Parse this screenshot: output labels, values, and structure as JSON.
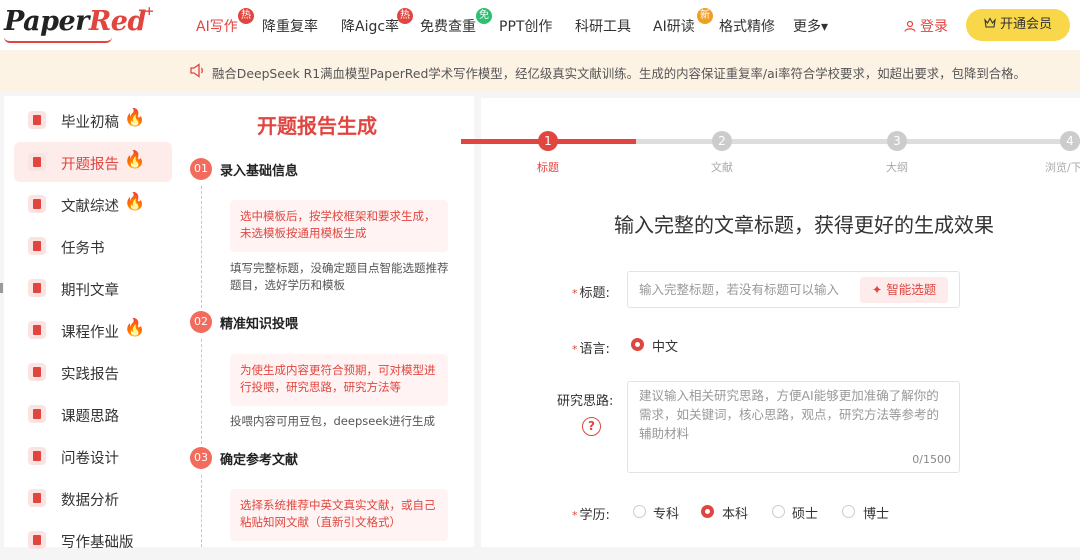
{
  "brand": {
    "name_part1": "Paper",
    "name_part2": "Red",
    "mark": "+"
  },
  "nav": [
    {
      "label": "AI写作",
      "badge": "热",
      "badge_type": "hot",
      "active": true
    },
    {
      "label": "降重复率",
      "badge": "",
      "badge_type": ""
    },
    {
      "label": "降Aigc率",
      "badge": "热",
      "badge_type": "hot"
    },
    {
      "label": "免费查重",
      "badge": "免",
      "badge_type": "free"
    },
    {
      "label": "PPT创作",
      "badge": "",
      "badge_type": ""
    },
    {
      "label": "科研工具",
      "badge": "",
      "badge_type": ""
    },
    {
      "label": "AI研读",
      "badge": "新",
      "badge_type": "new"
    },
    {
      "label": "格式精修",
      "badge": "",
      "badge_type": ""
    },
    {
      "label": "更多▾",
      "badge": "",
      "badge_type": ""
    }
  ],
  "header": {
    "login_label": "登录",
    "vip_label": "开通会员"
  },
  "notice": {
    "text": "融合DeepSeek R1满血模型PaperRed学术写作模型，经亿级真实文献训练。生成的内容保证重复率/ai率符合学校要求，如超出要求，包降到合格。"
  },
  "sidebar": {
    "items": [
      {
        "label": "毕业初稿",
        "hot": true
      },
      {
        "label": "开题报告",
        "hot": true,
        "active": true
      },
      {
        "label": "文献综述",
        "hot": true
      },
      {
        "label": "任务书",
        "hot": false
      },
      {
        "label": "期刊文章",
        "hot": false
      },
      {
        "label": "课程作业",
        "hot": true
      },
      {
        "label": "实践报告",
        "hot": false
      },
      {
        "label": "课题思路",
        "hot": false
      },
      {
        "label": "问卷设计",
        "hot": false
      },
      {
        "label": "数据分析",
        "hot": false
      },
      {
        "label": "写作基础版",
        "hot": false
      }
    ]
  },
  "guide": {
    "title": "开题报告生成",
    "steps": [
      {
        "num": "01",
        "heading": "录入基础信息",
        "tip": "选中模板后，按学校框架和要求生成，未选模板按通用模板生成",
        "desc": "填写完整标题，没确定题目点智能选题推荐题目，选好学历和模板"
      },
      {
        "num": "02",
        "heading": "精准知识投喂",
        "tip": "为使生成内容更符合预期，可对模型进行投喂，研究思路，研究方法等",
        "desc": "投喂内容可用豆包，deepseek进行生成"
      },
      {
        "num": "03",
        "heading": "确定参考文献",
        "tip": "选择系统推荐中英文真实文献，或自己粘贴知网文献（直新引文格式）",
        "desc": ""
      }
    ]
  },
  "progress": {
    "current": 1,
    "steps": [
      {
        "num": "1",
        "label": "标题"
      },
      {
        "num": "2",
        "label": "文献"
      },
      {
        "num": "3",
        "label": "大纲"
      },
      {
        "num": "4",
        "label": "浏览/下"
      }
    ]
  },
  "form": {
    "heading": "输入完整的文章标题，获得更好的生成效果",
    "title_label": "标题:",
    "title_placeholder": "输入完整标题，若没有标题可以输入",
    "smart_button": "智能选题",
    "language_label": "语言:",
    "language_options": [
      {
        "label": "中文",
        "checked": true
      }
    ],
    "thinking_label": "研究思路:",
    "thinking_placeholder": "建议输入相关研究思路，方便AI能够更加准确了解你的需求，如关键词，核心思路，观点，研究方法等参考的辅助材料",
    "thinking_counter": "0/1500",
    "degree_label": "学历:",
    "degree_options": [
      {
        "label": "专科",
        "checked": false
      },
      {
        "label": "本科",
        "checked": true
      },
      {
        "label": "硕士",
        "checked": false
      },
      {
        "label": "博士",
        "checked": false
      }
    ]
  },
  "colors": {
    "accent": "#e0463f",
    "vip": "#f9d74a",
    "notice_bg": "#fdf3e5"
  }
}
